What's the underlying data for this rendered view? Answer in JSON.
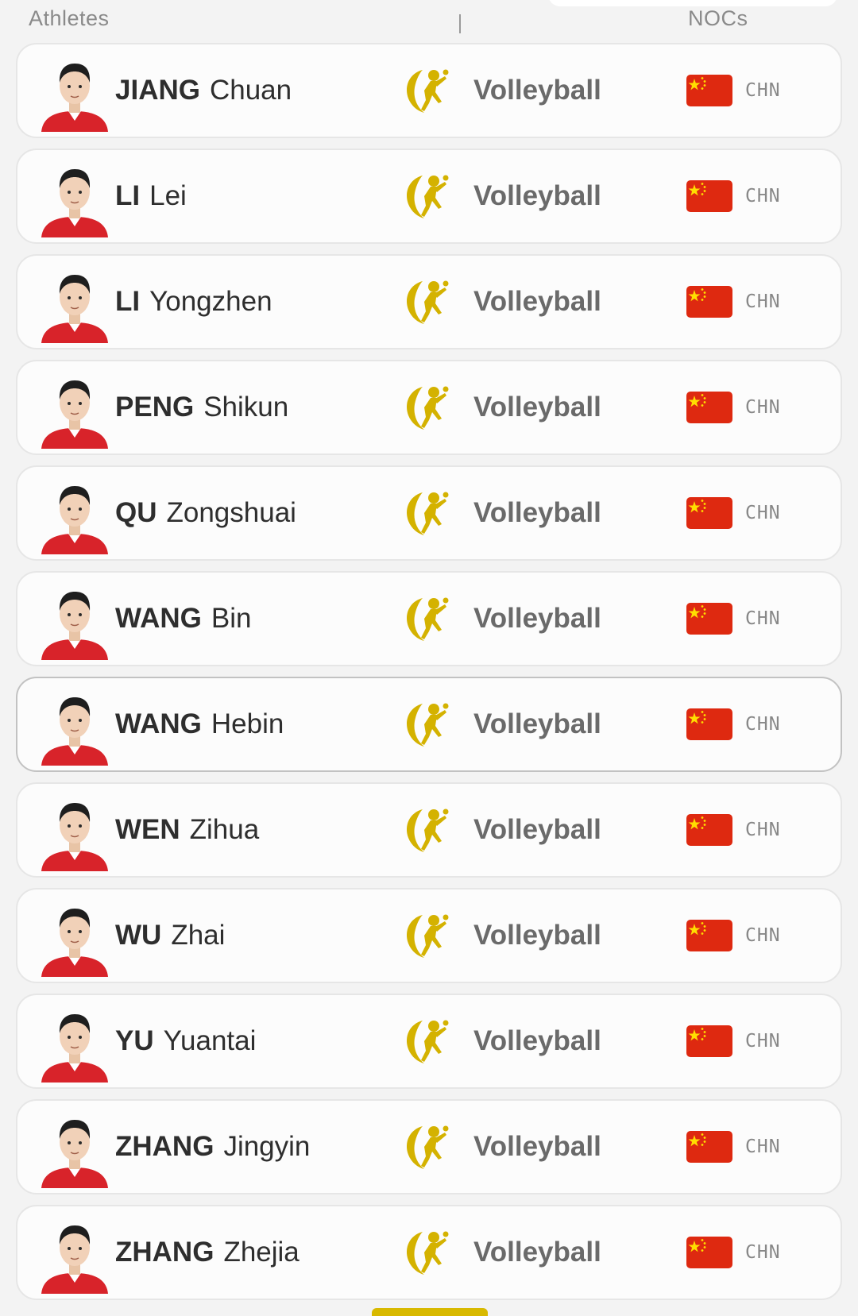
{
  "header": {
    "athletes_label": "Athletes",
    "nocs_label": "NOCs"
  },
  "colors": {
    "sport_icon": "#d4b200",
    "flag_red": "#de2910",
    "flag_star": "#ffde00",
    "jersey_red": "#d8232a"
  },
  "icons": {
    "sport": "volleyball-pictogram-icon",
    "flag": "china-flag-icon",
    "avatar": "athlete-avatar"
  },
  "athletes": [
    {
      "family": "JIANG",
      "given": "Chuan",
      "sport": "Volleyball",
      "noc": "CHN",
      "selected": false
    },
    {
      "family": "LI",
      "given": "Lei",
      "sport": "Volleyball",
      "noc": "CHN",
      "selected": false
    },
    {
      "family": "LI",
      "given": "Yongzhen",
      "sport": "Volleyball",
      "noc": "CHN",
      "selected": false
    },
    {
      "family": "PENG",
      "given": "Shikun",
      "sport": "Volleyball",
      "noc": "CHN",
      "selected": false
    },
    {
      "family": "QU",
      "given": "Zongshuai",
      "sport": "Volleyball",
      "noc": "CHN",
      "selected": false
    },
    {
      "family": "WANG",
      "given": "Bin",
      "sport": "Volleyball",
      "noc": "CHN",
      "selected": false
    },
    {
      "family": "WANG",
      "given": "Hebin",
      "sport": "Volleyball",
      "noc": "CHN",
      "selected": true
    },
    {
      "family": "WEN",
      "given": "Zihua",
      "sport": "Volleyball",
      "noc": "CHN",
      "selected": false
    },
    {
      "family": "WU",
      "given": "Zhai",
      "sport": "Volleyball",
      "noc": "CHN",
      "selected": false
    },
    {
      "family": "YU",
      "given": "Yuantai",
      "sport": "Volleyball",
      "noc": "CHN",
      "selected": false
    },
    {
      "family": "ZHANG",
      "given": "Jingyin",
      "sport": "Volleyball",
      "noc": "CHN",
      "selected": false
    },
    {
      "family": "ZHANG",
      "given": "Zhejia",
      "sport": "Volleyball",
      "noc": "CHN",
      "selected": false
    }
  ]
}
